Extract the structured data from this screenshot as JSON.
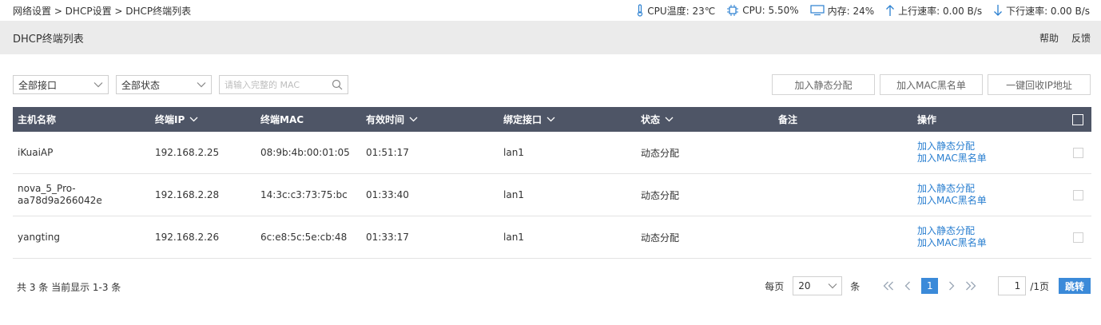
{
  "breadcrumb": "网络设置 > DHCP设置 > DHCP终端列表",
  "stats": {
    "cpu_temp": "CPU温度: 23℃",
    "cpu": "CPU: 5.50%",
    "memory": "内存: 24%",
    "upload": "上行速率: 0.00 B/s",
    "download": "下行速率: 0.00 B/s"
  },
  "title": "DHCP终端列表",
  "title_links": {
    "help": "帮助",
    "feedback": "反馈"
  },
  "filters": {
    "interface": "全部接口",
    "status": "全部状态",
    "search_placeholder": "请输入完整的 MAC"
  },
  "actions": {
    "add_static": "加入静态分配",
    "add_blacklist": "加入MAC黑名单",
    "reclaim_ip": "一键回收IP地址"
  },
  "columns": [
    "主机名称",
    "终端IP",
    "终端MAC",
    "有效时间",
    "绑定接口",
    "状态",
    "备注",
    "操作"
  ],
  "rows": [
    {
      "host": "iKuaiAP",
      "ip": "192.168.2.25",
      "mac": "08:9b:4b:00:01:05",
      "lease": "01:51:17",
      "iface": "lan1",
      "state": "动态分配",
      "note": "",
      "op1": "加入静态分配",
      "op2": "加入MAC黑名单"
    },
    {
      "host": "nova_5_Pro-aa78d9a266042e",
      "ip": "192.168.2.28",
      "mac": "14:3c:c3:73:75:bc",
      "lease": "01:33:40",
      "iface": "lan1",
      "state": "动态分配",
      "note": "",
      "op1": "加入静态分配",
      "op2": "加入MAC黑名单"
    },
    {
      "host": "yangting",
      "ip": "192.168.2.26",
      "mac": "6c:e8:5c:5e:cb:48",
      "lease": "01:33:17",
      "iface": "lan1",
      "state": "动态分配",
      "note": "",
      "op1": "加入静态分配",
      "op2": "加入MAC黑名单"
    }
  ],
  "footer": {
    "summary": "共 3 条 当前显示 1-3 条",
    "per_page": "每页",
    "page_size": "20",
    "unit": "条",
    "current_page": "1",
    "goto_page": "1",
    "total_pages": "/1页",
    "jump": "跳转"
  },
  "colors": {
    "header_bg": "#4e5566",
    "link": "#2a7fd0",
    "accent": "#3b8ad9"
  }
}
